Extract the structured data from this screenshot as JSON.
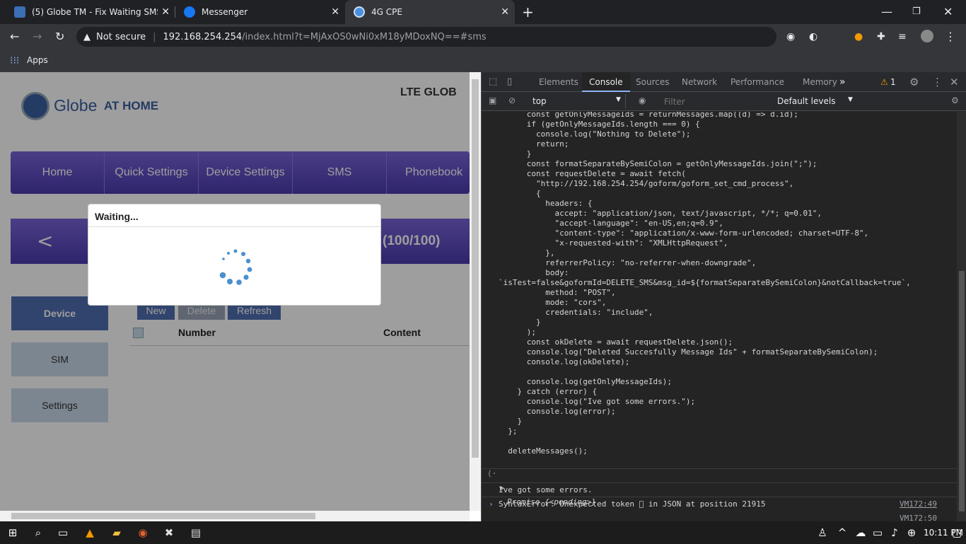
{
  "browser": {
    "tabs": [
      {
        "title": "(5) Globe TM - Fix Waiting SMS S",
        "icon": "globe-tm-favicon",
        "color": "#3b6fb6"
      },
      {
        "title": "Messenger",
        "icon": "messenger-favicon",
        "color": "#1877f2"
      },
      {
        "title": "4G CPE",
        "icon": "globe-favicon",
        "color": "#4a90e2"
      }
    ],
    "new_tab": "+",
    "security": "Not secure",
    "url_host": "192.168.254.254",
    "url_path": "/index.html?t=MjAxOS0wNi0xM18yMDoxNQ==#sms",
    "bookmarks": {
      "apps": "Apps"
    }
  },
  "router": {
    "logo_text": "Globe",
    "logo_sub": "AT HOME",
    "header_right": "LTE GLOB",
    "nav": [
      "Home",
      "Quick Settings",
      "Device Settings",
      "SMS",
      "Phonebook"
    ],
    "back": "<",
    "counter": "(100/100)",
    "side": [
      "Device",
      "SIM",
      "Settings"
    ],
    "buttons": [
      "New",
      "Delete",
      "Refresh"
    ],
    "cols": [
      "Number",
      "Content"
    ],
    "dialog_title": "Waiting..."
  },
  "devtools": {
    "tabs": [
      "Elements",
      "Console",
      "Sources",
      "Network",
      "Performance",
      "Memory"
    ],
    "more": "»",
    "warnings": "1",
    "context": "top",
    "filter_placeholder": "Filter",
    "levels": "Default levels",
    "promise": "Promise {<pending>}",
    "log1": "Ive got some errors.",
    "log1_src": "VM172:49",
    "log2": "SyntaxError: Unexpected token \u0000 in JSON at position 21915",
    "log2_src": "VM172:50",
    "code": [
      "      const getOnlyMessageIds = returnMessages.map((d) => d.id);",
      "      if (getOnlyMessageIds.length === 0) {",
      "        console.log(\"Nothing to Delete\");",
      "        return;",
      "      }",
      "      const formatSeparateBySemiColon = getOnlyMessageIds.join(\";\");",
      "      const requestDelete = await fetch(",
      "        \"http://192.168.254.254/goform/goform_set_cmd_process\",",
      "        {",
      "          headers: {",
      "            accept: \"application/json, text/javascript, */*; q=0.01\",",
      "            \"accept-language\": \"en-US,en;q=0.9\",",
      "            \"content-type\": \"application/x-www-form-urlencoded; charset=UTF-8\",",
      "            \"x-requested-with\": \"XMLHttpRequest\",",
      "          },",
      "          referrerPolicy: \"no-referrer-when-downgrade\",",
      "          body:",
      "`isTest=false&goformId=DELETE_SMS&msg_id=${formatSeparateBySemiColon}&notCallback=true`,",
      "          method: \"POST\",",
      "          mode: \"cors\",",
      "          credentials: \"include\",",
      "        }",
      "      );",
      "      const okDelete = await requestDelete.json();",
      "      console.log(\"Deleted Succesfully Message Ids\" + formatSeparateBySemiColon);",
      "      console.log(okDelete);",
      "",
      "      console.log(getOnlyMessageIds);",
      "    } catch (error) {",
      "      console.log(\"Ive got some errors.\");",
      "      console.log(error);",
      "    }",
      "  };",
      "",
      "  deleteMessages();"
    ]
  },
  "taskbar": {
    "time": "10:11 PM"
  }
}
